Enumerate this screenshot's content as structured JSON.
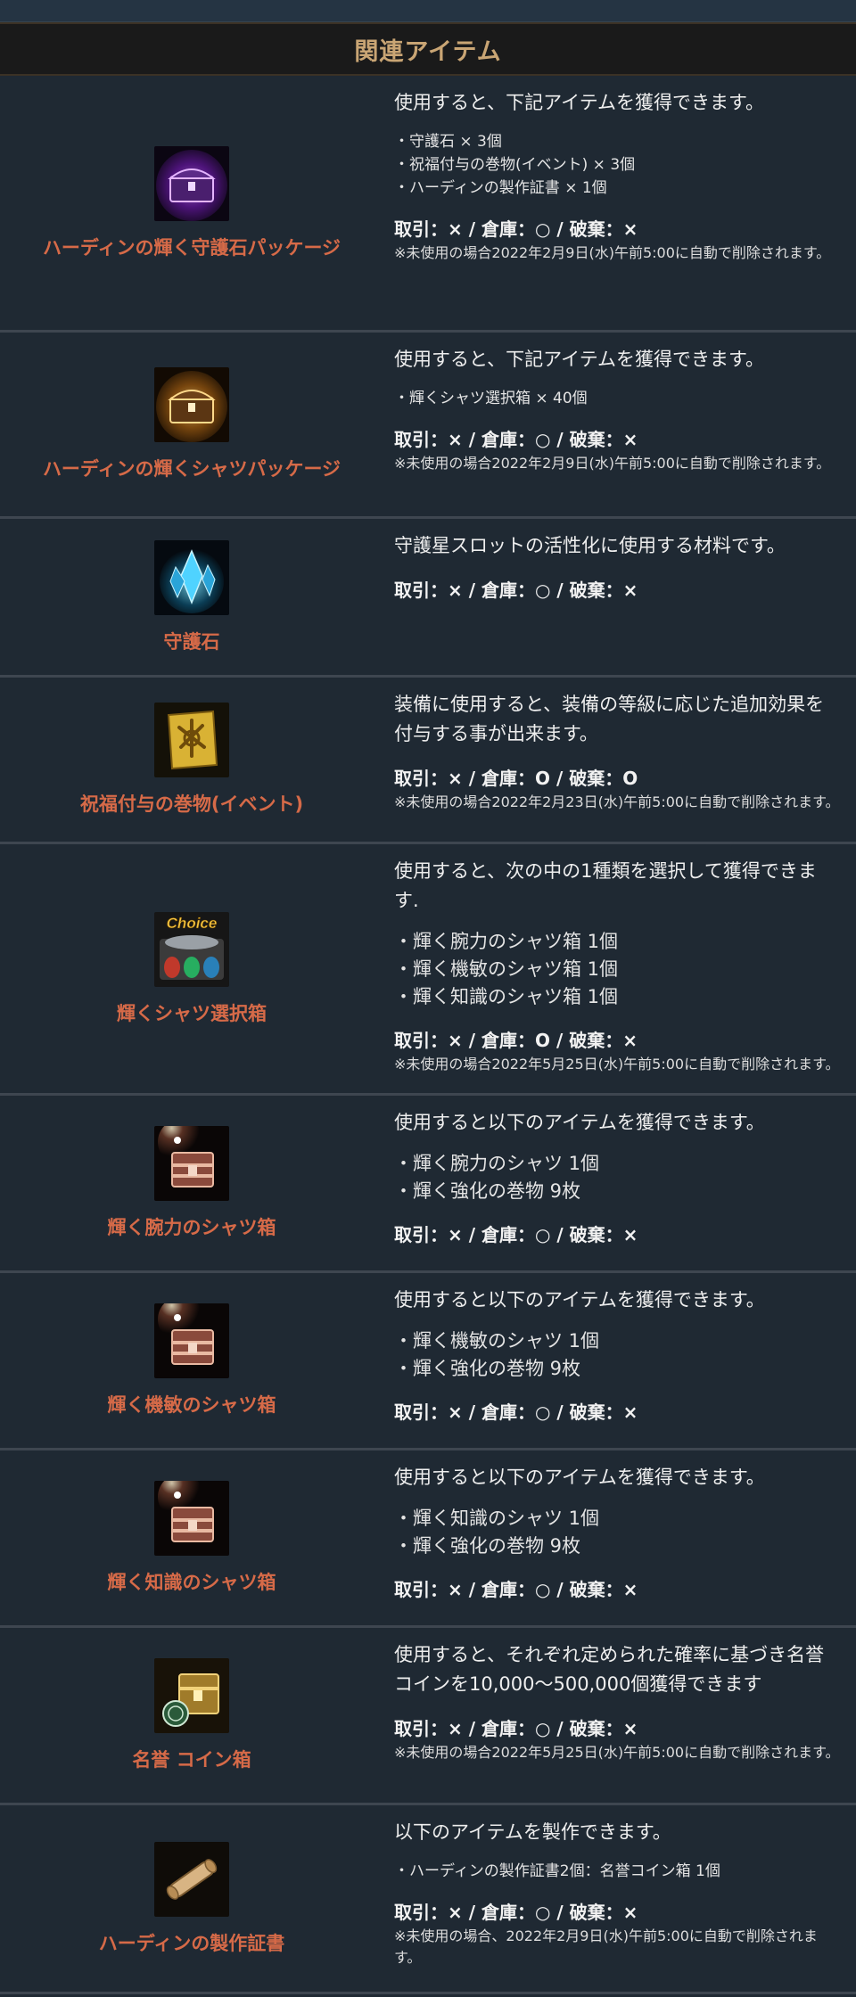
{
  "header": {
    "title": "関連アイテム"
  },
  "items": [
    {
      "name": "ハーディンの輝く守護石パッケージ",
      "icon": "purple-chest-icon",
      "description": "使用すると、下記アイテムを獲得できます。",
      "bullets": [
        "・守護石 × 3個",
        "・祝福付与の巻物(イベント) × 3個",
        "・ハーディンの製作証書 × 1個"
      ],
      "trade": "取引：× / 倉庫：○ / 破棄：×",
      "note": "※未使用の場合2022年2月9日(水)午前5:00に自動で削除されます。"
    },
    {
      "name": "ハーディンの輝くシャツパッケージ",
      "icon": "gold-chest-icon",
      "description": "使用すると、下記アイテムを獲得できます。",
      "bullets": [
        "・輝くシャツ選択箱 × 40個"
      ],
      "trade": "取引：× / 倉庫：○ / 破棄：×",
      "note": "※未使用の場合2022年2月9日(水)午前5:00に自動で削除されます。"
    },
    {
      "name": "守護石",
      "icon": "blue-crystal-icon",
      "description": "守護星スロットの活性化に使用する材料です。",
      "bullets": [],
      "trade": "取引：× / 倉庫：○ / 破棄：×",
      "note": ""
    },
    {
      "name": "祝福付与の巻物(イベント)",
      "icon": "gold-scroll-icon",
      "description": "装備に使用すると、装備の等級に応じた追加効果を付与する事が出来ます。",
      "bullets": [],
      "trade": "取引：× / 倉庫：O / 破棄：O",
      "note": "※未使用の場合2022年2月23日(水)午前5:00に自動で削除されます。"
    },
    {
      "name": "輝くシャツ選択箱",
      "icon": "choice-box-icon",
      "icon_text": "Choice",
      "description": "使用すると、次の中の1種類を選択して獲得できます.",
      "bullets": [
        "・輝く腕力のシャツ箱 1個",
        "・輝く機敏のシャツ箱 1個",
        "・輝く知識のシャツ箱 1個"
      ],
      "trade": "取引：× / 倉庫：O / 破棄：×",
      "note": "※未使用の場合2022年5月25日(水)午前5:00に自動で削除されます。"
    },
    {
      "name": "輝く腕力のシャツ箱",
      "icon": "shirt-chest-icon",
      "description": "使用すると以下のアイテムを獲得できます。",
      "bullets": [
        "・輝く腕力のシャツ 1個",
        "・輝く強化の巻物 9枚"
      ],
      "trade": "取引：× / 倉庫：○ / 破棄：×",
      "note": ""
    },
    {
      "name": "輝く機敏のシャツ箱",
      "icon": "shirt-chest-icon",
      "description": "使用すると以下のアイテムを獲得できます。",
      "bullets": [
        "・輝く機敏のシャツ 1個",
        "・輝く強化の巻物 9枚"
      ],
      "trade": "取引：× / 倉庫：○ / 破棄：×",
      "note": ""
    },
    {
      "name": "輝く知識のシャツ箱",
      "icon": "shirt-chest-icon",
      "description": "使用すると以下のアイテムを獲得できます。",
      "bullets": [
        "・輝く知識のシャツ 1個",
        "・輝く強化の巻物 9枚"
      ],
      "trade": "取引：× / 倉庫：○ / 破棄：×",
      "note": ""
    },
    {
      "name": "名誉 コイン箱",
      "icon": "coin-chest-icon",
      "description": "使用すると、それぞれ定められた確率に基づき名誉コインを10,000～500,000個獲得できます",
      "bullets": [],
      "trade": "取引：× / 倉庫：○ / 破棄：×",
      "note": "※未使用の場合2022年5月25日(水)午前5:00に自動で削除されます。"
    },
    {
      "name": "ハーディンの製作証書",
      "icon": "rolled-scroll-icon",
      "description": "以下のアイテムを製作できます。",
      "bullets": [
        "・ハーディンの製作証書2個：名誉コイン箱 1個"
      ],
      "trade": "取引：× / 倉庫：○ / 破棄：×",
      "note": "※未使用の場合、2022年2月9日(水)午前5:00に自動で削除されます。"
    }
  ]
}
